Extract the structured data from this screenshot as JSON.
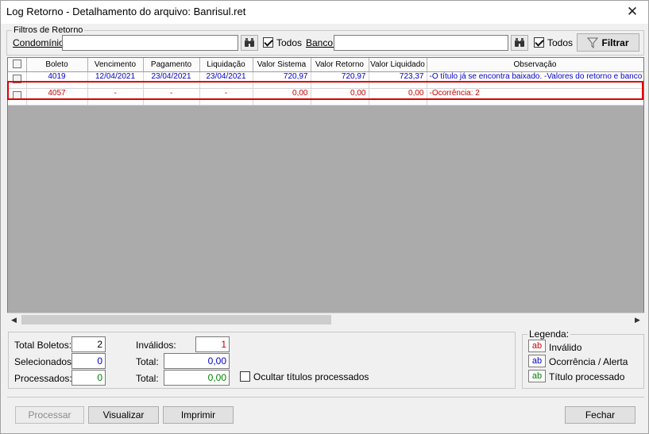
{
  "window": {
    "title": "Log Retorno - Detalhamento do arquivo: Banrisul.ret",
    "close_glyph": "✕"
  },
  "filters": {
    "legend": "Filtros de Retorno",
    "condominio_label": "Condomínio:",
    "condominio_value": "",
    "todos_condominio_label": "Todos",
    "banco_label": "Banco:",
    "banco_value": "",
    "todos_banco_label": "Todos",
    "filter_button_label": "Filtrar",
    "search_icon": "binoculars-icon",
    "filter_icon": "funnel-icon"
  },
  "table": {
    "columns": [
      "Boleto",
      "Vencimento",
      "Pagamento",
      "Liquidação",
      "Valor Sistema",
      "Valor Retorno",
      "Valor Liquidado",
      "Observação"
    ],
    "rows": [
      {
        "boleto": "4019",
        "vencimento": "12/04/2021",
        "pagamento": "23/04/2021",
        "liquidacao": "23/04/2021",
        "valor_sistema": "720,97",
        "valor_retorno": "720,97",
        "valor_liquidado": "723,37",
        "observacao": "-O título já se encontra baixado. -Valores do retorno e banco de",
        "color": "#0000c8"
      },
      {
        "boleto": "4057",
        "vencimento": "-",
        "pagamento": "-",
        "liquidacao": "-",
        "valor_sistema": "0,00",
        "valor_retorno": "0,00",
        "valor_liquidado": "0,00",
        "observacao": "-Ocorrência: 2",
        "color": "#c80000"
      }
    ]
  },
  "summary": {
    "total_boletos_label": "Total Boletos:",
    "total_boletos_value": "2",
    "selecionados_label": "Selecionados:",
    "selecionados_value": "0",
    "processados_label": "Processados:",
    "processados_value": "0",
    "invalidos_label": "Inválidos:",
    "invalidos_value": "1",
    "total_label_1": "Total:",
    "total_value_1": "0,00",
    "total_label_2": "Total:",
    "total_value_2": "0,00",
    "ocultar_label": "Ocultar títulos processados"
  },
  "legend": {
    "title": "Legenda:",
    "items": [
      {
        "swatch": "ab",
        "label": "Inválido",
        "color": "#c80000"
      },
      {
        "swatch": "ab",
        "label": "Ocorrência / Alerta",
        "color": "#0000c8"
      },
      {
        "swatch": "ab",
        "label": "Título processado",
        "color": "#008000"
      }
    ]
  },
  "buttons": {
    "processar": "Processar",
    "visualizar": "Visualizar",
    "imprimir": "Imprimir",
    "fechar": "Fechar"
  }
}
